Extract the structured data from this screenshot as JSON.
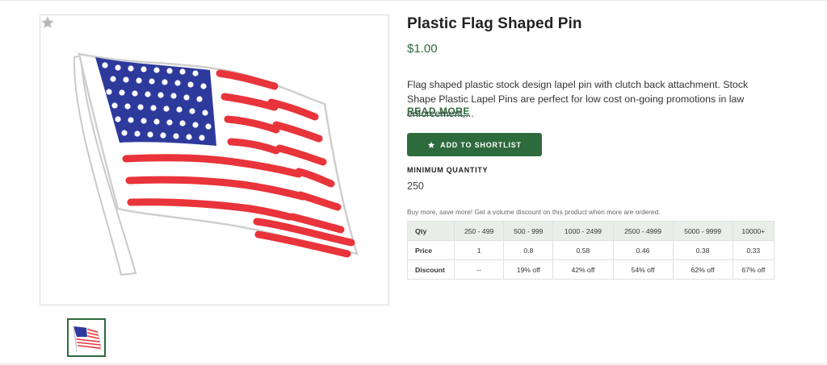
{
  "product": {
    "title": "Plastic Flag Shaped Pin",
    "price": "$1.00",
    "description": "Flag shaped plastic stock design lapel pin with clutch back attachment. Stock Shape Plastic Lapel Pins are perfect for low cost on-going promotions in law enforcement,...",
    "read_more": "READ MORE"
  },
  "actions": {
    "shortlist_label": "ADD TO SHORTLIST"
  },
  "minimum": {
    "label": "MINIMUM QUANTITY",
    "value": "250"
  },
  "volume_note": "Buy more, save more! Get a volume discount on this product when more are ordered.",
  "pricing_table": {
    "headers": [
      "Qty",
      "250 - 499",
      "500 - 999",
      "1000 - 2499",
      "2500 - 4999",
      "5000 - 9999",
      "10000+"
    ],
    "rows": [
      {
        "label": "Price",
        "cells": [
          "1",
          "0.8",
          "0.58",
          "0.46",
          "0.38",
          "0.33"
        ]
      },
      {
        "label": "Discount",
        "cells": [
          "--",
          "19% off",
          "42% off",
          "54% off",
          "62% off",
          "67% off"
        ]
      }
    ]
  },
  "icons": {
    "favorite": "star-icon",
    "button": "star-icon"
  },
  "colors": {
    "brand_green": "#2e6b3c",
    "flag_red": "#e8343a",
    "flag_blue": "#2d3a9c"
  }
}
